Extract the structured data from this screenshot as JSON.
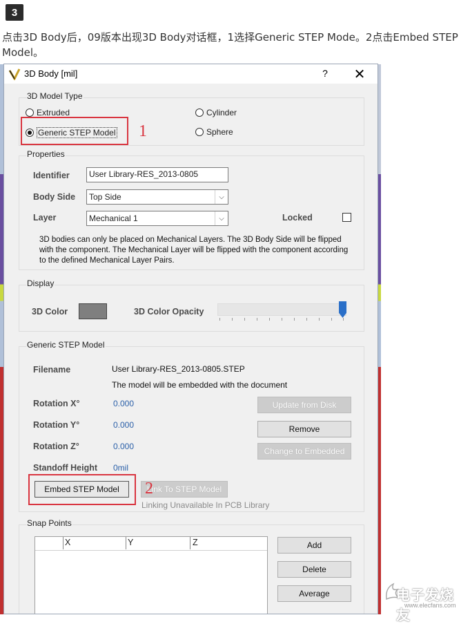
{
  "step_number": "3",
  "intro_text": "点击3D Body后，09版本出现3D Body对话框，1选择Generic STEP Mode。2点击Embed STEP Model。",
  "dialog": {
    "title": "3D Body [mil]",
    "help": "?",
    "close": "✕"
  },
  "model_type": {
    "title": "3D Model Type",
    "extruded": "Extruded",
    "generic_step": "Generic STEP Model",
    "cylinder": "Cylinder",
    "sphere": "Sphere",
    "selected": "Generic STEP Model"
  },
  "properties": {
    "title": "Properties",
    "identifier_label": "Identifier",
    "identifier_value": "User Library-RES_2013-0805",
    "body_side_label": "Body Side",
    "body_side_value": "Top Side",
    "layer_label": "Layer",
    "layer_value": "Mechanical 1",
    "locked_label": "Locked",
    "note": "3D bodies can only be placed on Mechanical Layers. The 3D Body Side will be flipped with the component. The Mechanical Layer will be flipped with the component according to the defined Mechanical Layer Pairs."
  },
  "display": {
    "title": "Display",
    "color_label": "3D Color",
    "opacity_label": "3D Color Opacity",
    "color": "#7f7f7f",
    "opacity_level": 1.0
  },
  "step_model": {
    "title": "Generic STEP Model",
    "filename_label": "Filename",
    "filename_value": "User Library-RES_2013-0805.STEP",
    "embed_note": "The model will be embedded with the document",
    "rot_x_label": "Rotation X°",
    "rot_x_value": "0.000",
    "rot_y_label": "Rotation Y°",
    "rot_y_value": "0.000",
    "rot_z_label": "Rotation Z°",
    "rot_z_value": "0.000",
    "standoff_label": "Standoff Height",
    "standoff_value": "0mil",
    "update_btn": "Update from Disk",
    "remove_btn": "Remove",
    "change_btn": "Change to Embedded",
    "embed_btn": "Embed STEP Model",
    "link_btn": "Link To STEP Model",
    "link_note": "Linking Unavailable In PCB Library"
  },
  "snap_points": {
    "title": "Snap Points",
    "columns": [
      "X",
      "Y",
      "Z"
    ],
    "add_btn": "Add",
    "delete_btn": "Delete",
    "average_btn": "Average"
  },
  "annotations": {
    "marker_1": "1",
    "marker_2": "2",
    "color": "#d9343f"
  },
  "watermark": {
    "text": "电子发烧友",
    "url": "www.elecfans.com"
  }
}
